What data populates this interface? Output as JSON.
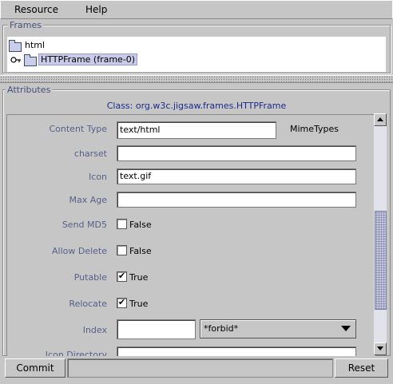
{
  "menu": {
    "items": [
      {
        "label": "Resource"
      },
      {
        "label": "Help"
      }
    ]
  },
  "frames": {
    "legend": "Frames",
    "tree": [
      {
        "label": "html",
        "icon": "folder-icon"
      },
      {
        "label": "HTTPFrame (frame-0)",
        "icon": "folder-icon",
        "expander": "key-expand-icon",
        "selected": true
      }
    ]
  },
  "attributes": {
    "legend": "Attributes",
    "class_line": "Class: org.w3c.jigsaw.frames.HTTPFrame",
    "content_type": {
      "label": "Content Type",
      "value": "text/html",
      "extra": "MimeTypes"
    },
    "charset": {
      "label": "charset",
      "value": ""
    },
    "icon": {
      "label": "Icon",
      "value": "text.gif"
    },
    "max_age": {
      "label": "Max Age",
      "value": ""
    },
    "send_md5": {
      "label": "Send MD5",
      "checked": false,
      "text": "False"
    },
    "allow_delete": {
      "label": "Allow Delete",
      "checked": false,
      "text": "False"
    },
    "putable": {
      "label": "Putable",
      "checked": true,
      "text": "True",
      "mark": "✔"
    },
    "relocate": {
      "label": "Relocate",
      "checked": true,
      "text": "True",
      "mark": "✔"
    },
    "index": {
      "label": "Index",
      "value": "",
      "select_value": "*forbid*"
    },
    "icon_directory": {
      "label": "Icon Directory",
      "value": ""
    }
  },
  "scrollbar": {
    "thumb_start": 0.39,
    "thumb_end": 0.84
  },
  "buttons": {
    "commit": "Commit",
    "reset": "Reset"
  },
  "colors": {
    "label_text": "#57608a",
    "class_text": "#1e2a8a",
    "selection": "#c9cbe8",
    "background": "#c6c6c6"
  }
}
